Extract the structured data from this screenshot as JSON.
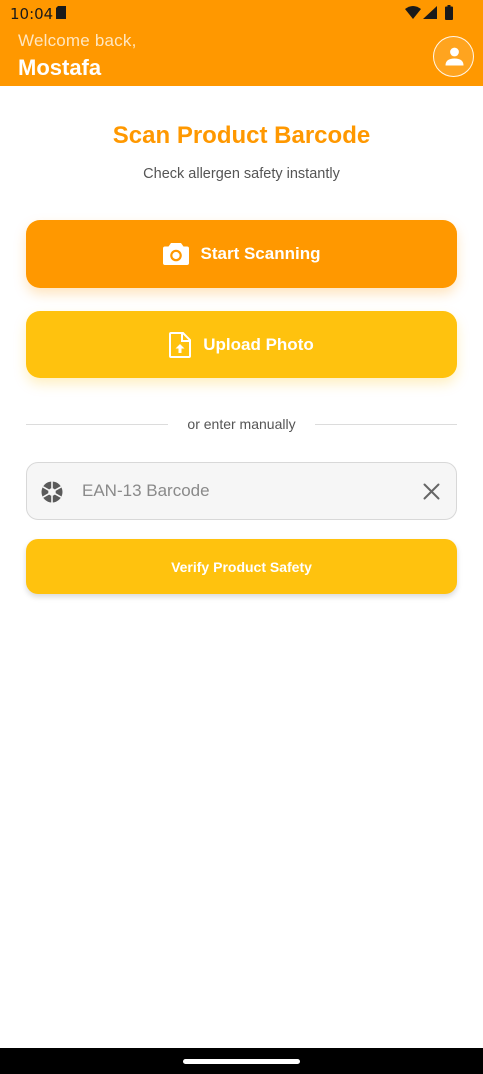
{
  "status_bar": {
    "time": "10:04",
    "icons": [
      "sim-card-icon",
      "wifi-icon",
      "cellular-signal-icon",
      "battery-icon"
    ]
  },
  "header": {
    "greeting": "Welcome back,",
    "username": "Mostafa",
    "avatar_icon": "person-icon"
  },
  "main": {
    "title": "Scan Product Barcode",
    "subtitle": "Check allergen safety instantly",
    "scan_button": {
      "label": "Start Scanning",
      "icon": "camera-icon"
    },
    "upload_button": {
      "label": "Upload Photo",
      "icon": "upload-file-icon"
    },
    "divider_text": "or enter manually",
    "barcode_input": {
      "placeholder": "EAN-13 Barcode",
      "value": "",
      "icon": "aperture-icon",
      "clear_icon": "close-icon"
    },
    "verify_button": {
      "label": "Verify Product Safety"
    }
  },
  "colors": {
    "primary": "#ff9800",
    "secondary": "#ffc20e",
    "welcome_text": "#ffe6bf"
  }
}
